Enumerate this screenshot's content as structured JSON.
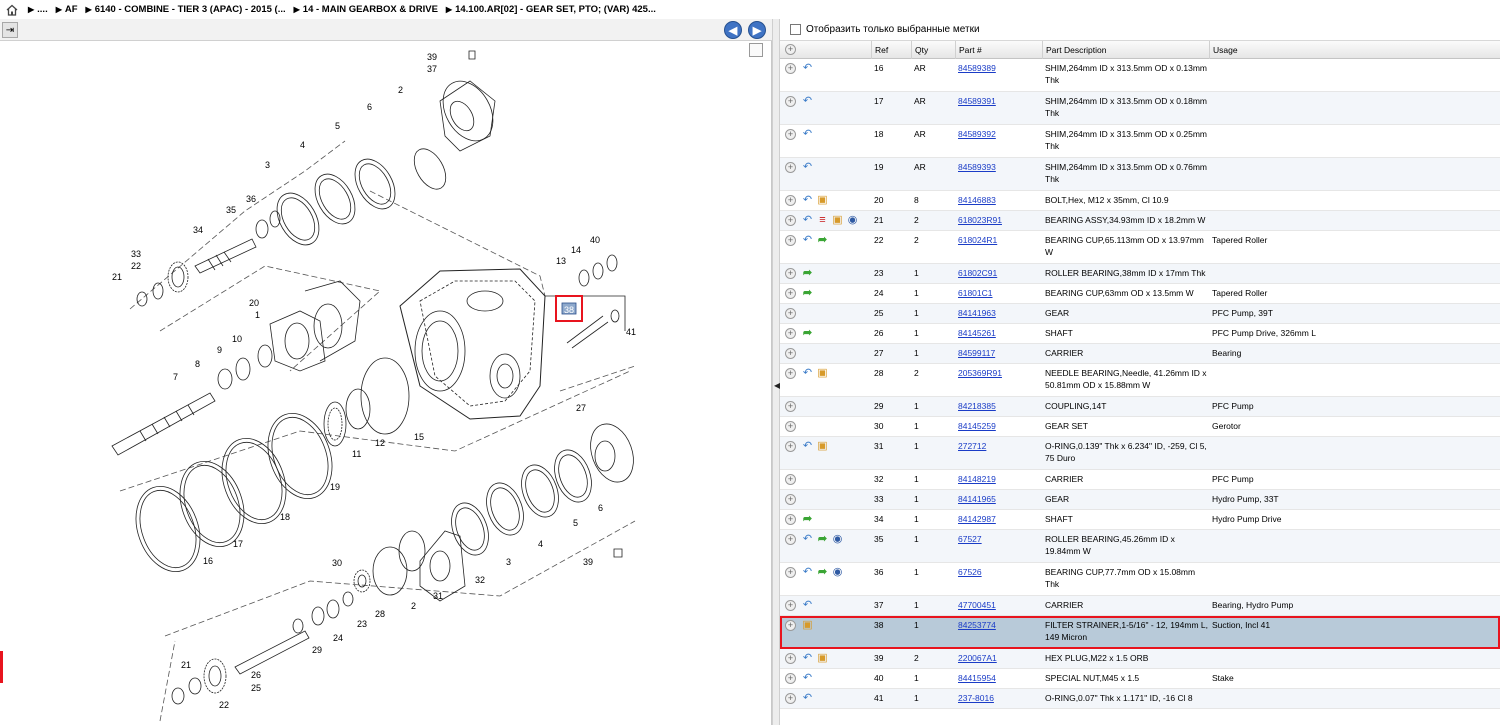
{
  "breadcrumb": {
    "crumbs": [
      "....",
      "AF",
      "6140 - COMBINE - TIER 3 (APAC) - 2015 (...",
      "14 - MAIN GEARBOX & DRIVE",
      "14.100.AR[02] - GEAR SET, PTO; (VAR) 425..."
    ]
  },
  "filter": {
    "label": "Отобразить только выбранные метки"
  },
  "table": {
    "headers": {
      "ref": "Ref",
      "qty": "Qty",
      "part": "Part #",
      "desc": "Part Description",
      "usage": "Usage"
    },
    "rows": [
      {
        "ref": "16",
        "qty": "AR",
        "part": "84589389",
        "desc": "SHIM,264mm ID x 313.5mm OD x 0.13mm Thk",
        "usage": "",
        "icons": [
          "back"
        ]
      },
      {
        "ref": "17",
        "qty": "AR",
        "part": "84589391",
        "desc": "SHIM,264mm ID x 313.5mm OD x 0.18mm Thk",
        "usage": "",
        "icons": [
          "back"
        ]
      },
      {
        "ref": "18",
        "qty": "AR",
        "part": "84589392",
        "desc": "SHIM,264mm ID x 313.5mm OD x 0.25mm Thk",
        "usage": "",
        "icons": [
          "back"
        ]
      },
      {
        "ref": "19",
        "qty": "AR",
        "part": "84589393",
        "desc": "SHIM,264mm ID x 313.5mm OD x 0.76mm Thk",
        "usage": "",
        "icons": [
          "back"
        ]
      },
      {
        "ref": "20",
        "qty": "8",
        "part": "84146883",
        "desc": "BOLT,Hex, M12 x 35mm, Cl 10.9",
        "usage": "",
        "icons": [
          "back",
          "box"
        ]
      },
      {
        "ref": "21",
        "qty": "2",
        "part": "618023R91",
        "desc": "BEARING ASSY,34.93mm ID x 18.2mm W",
        "usage": "",
        "icons": [
          "back",
          "list",
          "box",
          "globe"
        ]
      },
      {
        "ref": "22",
        "qty": "2",
        "part": "618024R1",
        "desc": "BEARING CUP,65.113mm OD x 13.97mm W",
        "usage": "Tapered Roller",
        "icons": [
          "back",
          "fwd"
        ]
      },
      {
        "ref": "23",
        "qty": "1",
        "part": "61802C91",
        "desc": "ROLLER BEARING,38mm ID x 17mm Thk",
        "usage": "",
        "icons": [
          "fwd"
        ]
      },
      {
        "ref": "24",
        "qty": "1",
        "part": "61801C1",
        "desc": "BEARING CUP,63mm OD x 13.5mm W",
        "usage": "Tapered Roller",
        "icons": [
          "fwd"
        ]
      },
      {
        "ref": "25",
        "qty": "1",
        "part": "84141963",
        "desc": "GEAR",
        "usage": "PFC Pump, 39T",
        "icons": []
      },
      {
        "ref": "26",
        "qty": "1",
        "part": "84145261",
        "desc": "SHAFT",
        "usage": "PFC Pump Drive, 326mm L",
        "icons": [
          "fwd"
        ]
      },
      {
        "ref": "27",
        "qty": "1",
        "part": "84599117",
        "desc": "CARRIER",
        "usage": "Bearing",
        "icons": []
      },
      {
        "ref": "28",
        "qty": "2",
        "part": "205369R91",
        "desc": "NEEDLE BEARING,Needle, 41.26mm ID x 50.81mm OD x 15.88mm W",
        "usage": "",
        "icons": [
          "back",
          "box"
        ]
      },
      {
        "ref": "29",
        "qty": "1",
        "part": "84218385",
        "desc": "COUPLING,14T",
        "usage": "PFC Pump",
        "icons": []
      },
      {
        "ref": "30",
        "qty": "1",
        "part": "84145259",
        "desc": "GEAR SET",
        "usage": "Gerotor",
        "icons": []
      },
      {
        "ref": "31",
        "qty": "1",
        "part": "272712",
        "desc": "O-RING,0.139\" Thk x 6.234\" ID, -259, Cl 5, 75 Duro",
        "usage": "",
        "icons": [
          "back",
          "box"
        ]
      },
      {
        "ref": "32",
        "qty": "1",
        "part": "84148219",
        "desc": "CARRIER",
        "usage": "PFC Pump",
        "icons": []
      },
      {
        "ref": "33",
        "qty": "1",
        "part": "84141965",
        "desc": "GEAR",
        "usage": "Hydro Pump, 33T",
        "icons": []
      },
      {
        "ref": "34",
        "qty": "1",
        "part": "84142987",
        "desc": "SHAFT",
        "usage": "Hydro Pump Drive",
        "icons": [
          "fwd"
        ]
      },
      {
        "ref": "35",
        "qty": "1",
        "part": "67527",
        "desc": "ROLLER BEARING,45.26mm ID x 19.84mm W",
        "usage": "",
        "icons": [
          "back",
          "fwd",
          "globe"
        ]
      },
      {
        "ref": "36",
        "qty": "1",
        "part": "67526",
        "desc": "BEARING CUP,77.7mm OD x 15.08mm Thk",
        "usage": "",
        "icons": [
          "back",
          "fwd",
          "globe"
        ]
      },
      {
        "ref": "37",
        "qty": "1",
        "part": "47700451",
        "desc": "CARRIER",
        "usage": "Bearing, Hydro Pump",
        "icons": [
          "back"
        ]
      },
      {
        "ref": "38",
        "qty": "1",
        "part": "84253774",
        "desc": "FILTER STRAINER,1-5/16\" - 12, 194mm L, 149 Micron",
        "usage": "Suction, Incl 41",
        "icons": [
          "box"
        ],
        "selected": true
      },
      {
        "ref": "39",
        "qty": "2",
        "part": "220067A1",
        "desc": "HEX PLUG,M22 x 1.5 ORB",
        "usage": "",
        "icons": [
          "back",
          "box"
        ]
      },
      {
        "ref": "40",
        "qty": "1",
        "part": "84415954",
        "desc": "SPECIAL NUT,M45 x 1.5",
        "usage": "Stake",
        "icons": [
          "back"
        ]
      },
      {
        "ref": "41",
        "qty": "1",
        "part": "237-8016",
        "desc": "O-RING,0.07\" Thk x 1.171\" ID, -16 Cl 8",
        "usage": "",
        "icons": [
          "back"
        ]
      }
    ]
  },
  "diagram": {
    "callouts": [
      "39",
      "37",
      "2",
      "6",
      "5",
      "4",
      "3",
      "36",
      "35",
      "34",
      "33",
      "22",
      "21",
      "20",
      "1",
      "10",
      "9",
      "8",
      "7",
      "11",
      "12",
      "15",
      "13",
      "14",
      "40",
      "38",
      "41",
      "27",
      "19",
      "18",
      "17",
      "16",
      "6",
      "5",
      "4",
      "3",
      "30",
      "2",
      "31",
      "32",
      "28",
      "23",
      "24",
      "29",
      "26",
      "25",
      "21",
      "22",
      "39"
    ]
  },
  "colors": {
    "link": "#1a3cc7",
    "selected_row": "#b8cad9",
    "highlight": "#e8141e",
    "nav_button": "#3f73c4"
  }
}
